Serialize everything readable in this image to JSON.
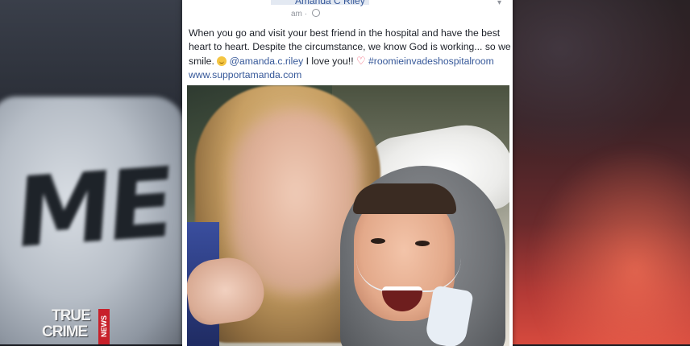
{
  "post": {
    "author": "Amanda C Riley",
    "meta_time": "am",
    "text_line1": "When you go and visit your best friend in the hospital and have the best heart to heart. Despite the circumstance, we know God is working... so we smile.",
    "mention": "@amanda.c.riley",
    "text_after_mention": " I love you!!",
    "hashtag": "#roomieinvadeshospitalroom",
    "link": "www.supportamanda.com"
  },
  "background": {
    "left_shirt_text": "ME"
  },
  "watermark": {
    "line1": "TRUE",
    "line2": "CRIME",
    "tag": "NEWS"
  },
  "icons": {
    "globe": "globe-icon",
    "emoji": "smile-icon",
    "heart": "heart-icon",
    "menu": "chevron-down-icon"
  },
  "colors": {
    "link": "#365899",
    "heart": "#f25268",
    "watermark_tag": "#c8202a"
  }
}
